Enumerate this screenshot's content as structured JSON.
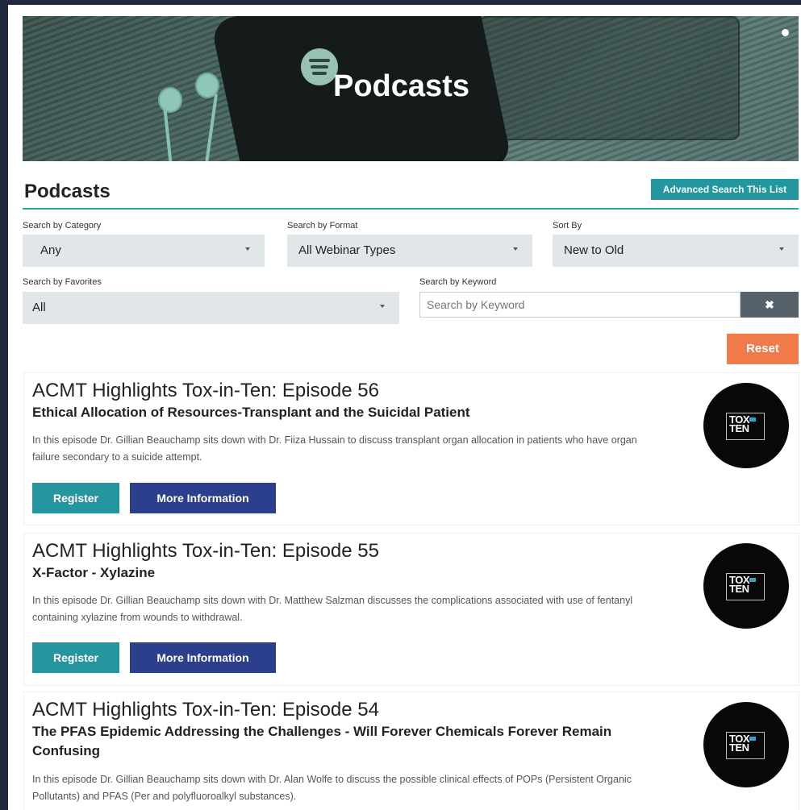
{
  "hero": {
    "title": "Podcasts"
  },
  "list": {
    "title": "Podcasts",
    "advanced_search_label": "Advanced Search This List"
  },
  "filters": {
    "category": {
      "label": "Search by Category",
      "value": "Any"
    },
    "format": {
      "label": "Search by Format",
      "value": "All Webinar Types"
    },
    "sort": {
      "label": "Sort By",
      "value": "New to Old"
    },
    "favorites": {
      "label": "Search by Favorites",
      "value": "All"
    },
    "keyword": {
      "label": "Search by Keyword",
      "placeholder": "Search by Keyword",
      "clear_icon": "✖"
    },
    "reset_label": "Reset"
  },
  "thumb": {
    "line1": "TOX",
    "line2": "TEN",
    "prefix": "IN"
  },
  "episodes": [
    {
      "title": "ACMT Highlights Tox-in-Ten: Episode 56",
      "subtitle": "Ethical Allocation of Resources-Transplant and the Suicidal Patient",
      "description": "In this episode Dr. Gillian Beauchamp sits down with Dr. Fiiza Hussain to discuss transplant organ allocation in patients who have organ failure secondary to a suicide attempt.",
      "register_label": "Register",
      "more_label": "More Information"
    },
    {
      "title": "ACMT Highlights Tox-in-Ten: Episode 55",
      "subtitle": "X-Factor - Xylazine",
      "description": "In this episode Dr. Gillian Beauchamp sits down with Dr. Matthew Salzman discusses the complications associated with use of fentanyl containing xylazine from wounds to withdrawal.",
      "register_label": "Register",
      "more_label": "More Information"
    },
    {
      "title": "ACMT Highlights Tox-in-Ten: Episode 54",
      "subtitle": "The PFAS Epidemic Addressing the Challenges - Will Forever Chemicals Forever Remain Confusing",
      "description": "In this episode Dr. Gillian Beauchamp sits down with Dr. Alan Wolfe to discuss the possible clinical effects of POPs (Persistent Organic Pollutants) and PFAS (Per and polyfluoroalkyl substances)."
    }
  ]
}
